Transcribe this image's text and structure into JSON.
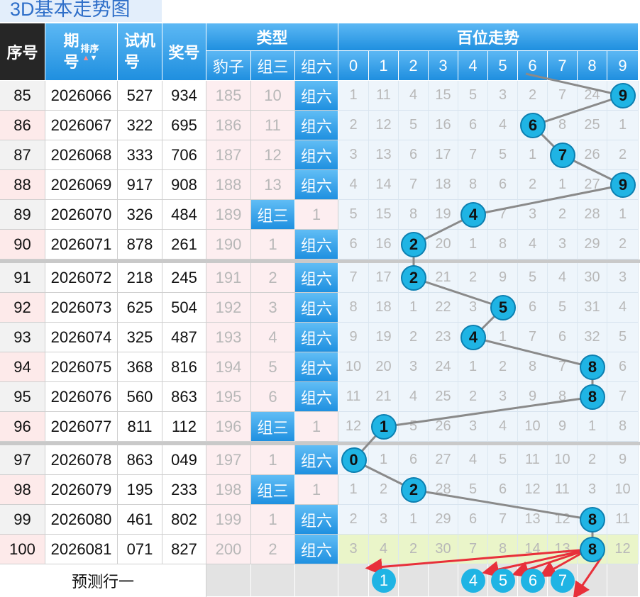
{
  "page_title": "3D基本走势图",
  "header": {
    "seq": "序号",
    "period_top": "期",
    "period_bottom": "号",
    "sort_label": "排序",
    "sort_up": "▲",
    "sort_down": "▼",
    "trial_top": "试机",
    "trial_bottom": "号",
    "prize": "奖号",
    "type_group": "类型",
    "type_cols": [
      "豹子",
      "组三",
      "组六"
    ],
    "hundreds_group": "百位走势",
    "digits": [
      "0",
      "1",
      "2",
      "3",
      "4",
      "5",
      "6",
      "7",
      "8",
      "9"
    ]
  },
  "rows": [
    {
      "seq": "85",
      "period": "2026066",
      "trial": "527",
      "prize": "934",
      "bao": "185",
      "z3": "10",
      "z6": "组六",
      "z6_hit": true,
      "z3_hit": false,
      "hit": 9,
      "miss": [
        "1",
        "11",
        "4",
        "15",
        "5",
        "3",
        "2",
        "7",
        "24",
        ""
      ]
    },
    {
      "seq": "86",
      "period": "2026067",
      "trial": "322",
      "prize": "695",
      "bao": "186",
      "z3": "11",
      "z6": "组六",
      "z6_hit": true,
      "z3_hit": false,
      "hit": 6,
      "miss": [
        "2",
        "12",
        "5",
        "16",
        "6",
        "4",
        "",
        "8",
        "25",
        "1"
      ]
    },
    {
      "seq": "87",
      "period": "2026068",
      "trial": "333",
      "prize": "706",
      "bao": "187",
      "z3": "12",
      "z6": "组六",
      "z6_hit": true,
      "z3_hit": false,
      "hit": 7,
      "miss": [
        "3",
        "13",
        "6",
        "17",
        "7",
        "5",
        "1",
        "",
        "26",
        "2"
      ]
    },
    {
      "seq": "88",
      "period": "2026069",
      "trial": "917",
      "prize": "908",
      "bao": "188",
      "z3": "13",
      "z6": "组六",
      "z6_hit": true,
      "z3_hit": false,
      "hit": 9,
      "miss": [
        "4",
        "14",
        "7",
        "18",
        "8",
        "6",
        "2",
        "1",
        "27",
        ""
      ]
    },
    {
      "seq": "89",
      "period": "2026070",
      "trial": "326",
      "prize": "484",
      "bao": "189",
      "z3": "组三",
      "z6": "1",
      "z6_hit": false,
      "z3_hit": true,
      "hit": 4,
      "miss": [
        "5",
        "15",
        "8",
        "19",
        "",
        "7",
        "3",
        "2",
        "28",
        "1"
      ]
    },
    {
      "seq": "90",
      "period": "2026071",
      "trial": "878",
      "prize": "261",
      "bao": "190",
      "z3": "1",
      "z6": "组六",
      "z6_hit": true,
      "z3_hit": false,
      "hit": 2,
      "miss": [
        "6",
        "16",
        "",
        "20",
        "1",
        "8",
        "4",
        "3",
        "29",
        "2"
      ]
    },
    {
      "seq": "91",
      "period": "2026072",
      "trial": "218",
      "prize": "245",
      "bao": "191",
      "z3": "2",
      "z6": "组六",
      "z6_hit": true,
      "z3_hit": false,
      "hit": 2,
      "miss": [
        "7",
        "17",
        "",
        "21",
        "2",
        "9",
        "5",
        "4",
        "30",
        "3"
      ]
    },
    {
      "seq": "92",
      "period": "2026073",
      "trial": "625",
      "prize": "504",
      "bao": "192",
      "z3": "3",
      "z6": "组六",
      "z6_hit": true,
      "z3_hit": false,
      "hit": 5,
      "miss": [
        "8",
        "18",
        "1",
        "22",
        "3",
        "",
        "6",
        "5",
        "31",
        "4"
      ]
    },
    {
      "seq": "93",
      "period": "2026074",
      "trial": "325",
      "prize": "487",
      "bao": "193",
      "z3": "4",
      "z6": "组六",
      "z6_hit": true,
      "z3_hit": false,
      "hit": 4,
      "miss": [
        "9",
        "19",
        "2",
        "23",
        "",
        "1",
        "7",
        "6",
        "32",
        "5"
      ]
    },
    {
      "seq": "94",
      "period": "2026075",
      "trial": "368",
      "prize": "816",
      "bao": "194",
      "z3": "5",
      "z6": "组六",
      "z6_hit": true,
      "z3_hit": false,
      "hit": 8,
      "miss": [
        "10",
        "20",
        "3",
        "24",
        "1",
        "2",
        "8",
        "7",
        "",
        "6"
      ]
    },
    {
      "seq": "95",
      "period": "2026076",
      "trial": "560",
      "prize": "863",
      "bao": "195",
      "z3": "6",
      "z6": "组六",
      "z6_hit": true,
      "z3_hit": false,
      "hit": 8,
      "miss": [
        "11",
        "21",
        "4",
        "25",
        "2",
        "3",
        "9",
        "8",
        "",
        "7"
      ]
    },
    {
      "seq": "96",
      "period": "2026077",
      "trial": "811",
      "prize": "112",
      "bao": "196",
      "z3": "组三",
      "z6": "1",
      "z6_hit": false,
      "z3_hit": true,
      "hit": 1,
      "miss": [
        "12",
        "",
        "5",
        "26",
        "3",
        "4",
        "10",
        "9",
        "1",
        "8"
      ]
    },
    {
      "seq": "97",
      "period": "2026078",
      "trial": "863",
      "prize": "049",
      "bao": "197",
      "z3": "1",
      "z6": "组六",
      "z6_hit": true,
      "z3_hit": false,
      "hit": 0,
      "miss": [
        "",
        "1",
        "6",
        "27",
        "4",
        "5",
        "11",
        "10",
        "2",
        "9"
      ]
    },
    {
      "seq": "98",
      "period": "2026079",
      "trial": "195",
      "prize": "233",
      "bao": "198",
      "z3": "组三",
      "z6": "1",
      "z6_hit": false,
      "z3_hit": true,
      "hit": 2,
      "miss": [
        "1",
        "2",
        "",
        "28",
        "5",
        "6",
        "12",
        "11",
        "3",
        "10"
      ]
    },
    {
      "seq": "99",
      "period": "2026080",
      "trial": "461",
      "prize": "802",
      "bao": "199",
      "z3": "1",
      "z6": "组六",
      "z6_hit": true,
      "z3_hit": false,
      "hit": 8,
      "miss": [
        "2",
        "3",
        "1",
        "29",
        "6",
        "7",
        "13",
        "12",
        "",
        "11"
      ]
    },
    {
      "seq": "100",
      "period": "2026081",
      "trial": "071",
      "prize": "827",
      "bao": "200",
      "z3": "2",
      "z6": "组六",
      "z6_hit": true,
      "z3_hit": false,
      "hit": 8,
      "miss": [
        "3",
        "4",
        "2",
        "30",
        "7",
        "8",
        "14",
        "13",
        "",
        "12"
      ]
    }
  ],
  "prediction": {
    "label": "预测行一",
    "balls": [
      "1",
      "4",
      "5",
      "6",
      "7"
    ],
    "ball_digits": [
      1,
      4,
      5,
      6,
      7
    ]
  },
  "colors": {
    "ball": "#1fb4e4",
    "trend_line": "#8a8a8a",
    "arrow": "#e8303a",
    "header_blue": "#2a95e2",
    "header_dark": "#262626"
  }
}
